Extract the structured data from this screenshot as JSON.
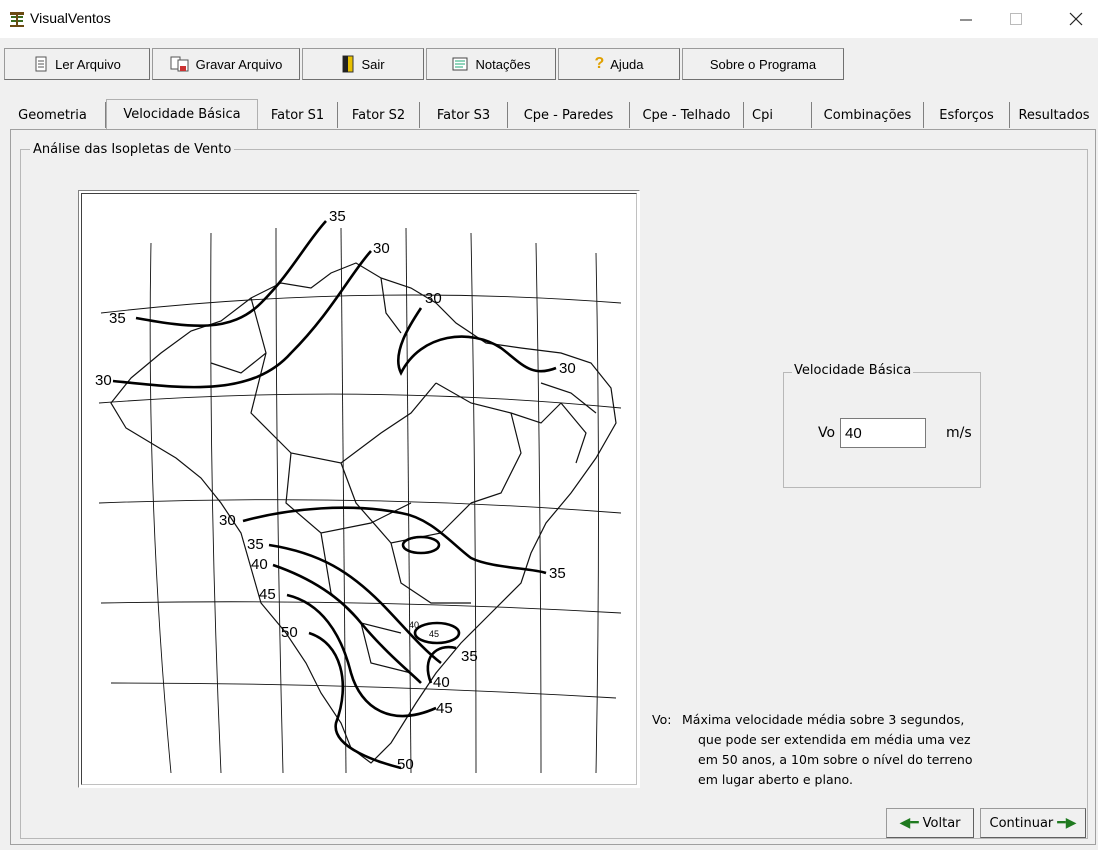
{
  "window": {
    "title": "VisualVentos"
  },
  "toolbar": {
    "buttons": [
      {
        "label": "Ler Arquivo",
        "icon": "document-icon"
      },
      {
        "label": "Gravar Arquivo",
        "icon": "save-icon"
      },
      {
        "label": "Sair",
        "icon": "exit-door-icon"
      },
      {
        "label": "Notações",
        "icon": "notes-icon"
      },
      {
        "label": "Ajuda",
        "icon": "help-icon"
      },
      {
        "label": "Sobre o Programa",
        "icon": ""
      }
    ]
  },
  "tabs": [
    {
      "label": "Geometria"
    },
    {
      "label": "Velocidade Básica",
      "active": true
    },
    {
      "label": "Fator S1"
    },
    {
      "label": "Fator S2"
    },
    {
      "label": "Fator S3"
    },
    {
      "label": "Cpe - Paredes"
    },
    {
      "label": "Cpe - Telhado"
    },
    {
      "label": "Cpi"
    },
    {
      "label": "Combinações"
    },
    {
      "label": "Esforços"
    },
    {
      "label": "Resultados"
    }
  ],
  "panel": {
    "group_title": "Análise das Isopletas de Vento"
  },
  "map": {
    "isopleth_labels": [
      "35",
      "30",
      "30",
      "35",
      "30",
      "30",
      "30",
      "35",
      "40",
      "45",
      "50",
      "35",
      "40",
      "45",
      "35",
      "40",
      "45",
      "50"
    ]
  },
  "velocidade": {
    "group_title": "Velocidade Básica",
    "label": "Vo",
    "value": "40",
    "unit": "m/s"
  },
  "note": {
    "label": "Vo:",
    "lines": [
      "Máxima velocidade média sobre 3 segundos,",
      "que pode ser extendida em média uma vez",
      "em 50 anos, a 10m sobre o nível do terreno",
      "em lugar aberto e plano."
    ]
  },
  "nav": {
    "back_label": "Voltar",
    "continue_label": "Continuar"
  },
  "colors": {
    "accent_arrow": "#1f7a1f",
    "background": "#f0f0f0"
  }
}
